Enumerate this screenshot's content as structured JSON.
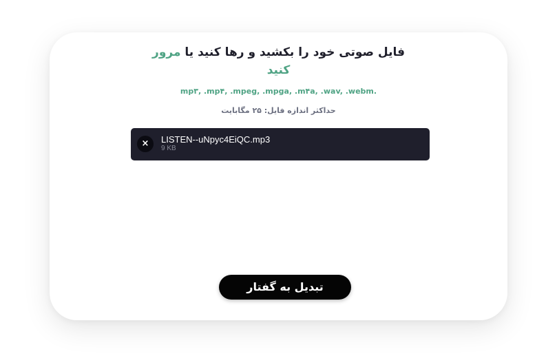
{
  "upload": {
    "title_line1": "فایل صوتی خود را بکشید و رها کنید یا",
    "browse_word_1": "مرور",
    "browse_word_2": "کنید",
    "formats": ".mp۳, .mp۴, .mpeg, .mpga, .m۴a, .wav, .webm",
    "max_size": "حداکثر اندازه فایل: ۲۵ مگابایت"
  },
  "file": {
    "name": "LISTEN--uNpyc4EiQC.mp3",
    "size": "9 KB",
    "remove_icon": "close-icon",
    "remove_symbol": "×"
  },
  "waveform": {
    "colors": [
      "#b34fc0",
      "#3f8fb0",
      "#58c8c8"
    ]
  },
  "action": {
    "convert_label": "تبدیل به گفتار"
  }
}
